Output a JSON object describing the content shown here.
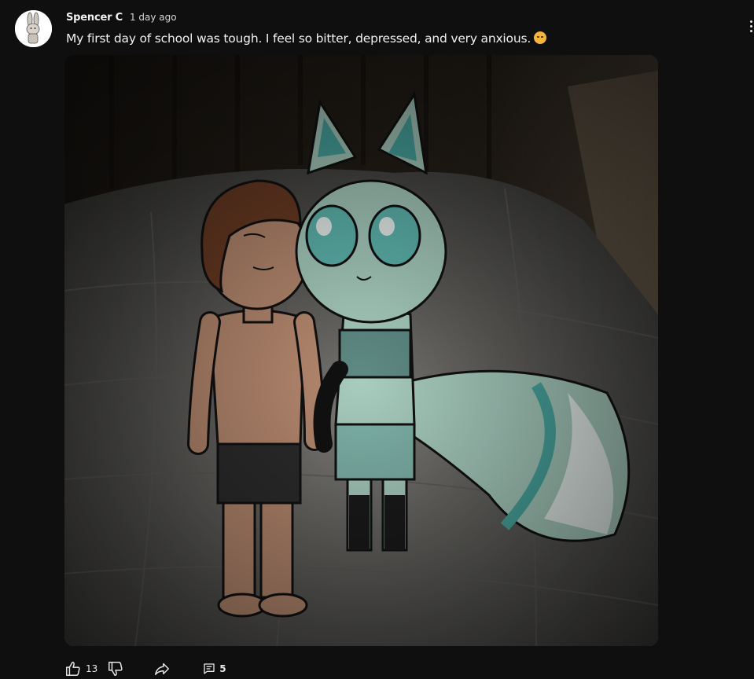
{
  "post": {
    "author": "Spencer C",
    "time_ago": "1 day ago",
    "text": "My first day of school was tough. I feel so bitter, depressed, and very anxious.",
    "emoji_icon": "pensive-face-icon"
  },
  "actions": {
    "like_count": "13",
    "comment_count": "5"
  },
  "icons": {
    "like": "thumbs-up-icon",
    "dislike": "thumbs-down-icon",
    "share": "share-arrow-icon",
    "comments": "comment-icon",
    "menu": "more-vertical-icon"
  },
  "colors": {
    "background": "#0f0f0f",
    "text": "#f1f1f1",
    "character_fox": "#a8d8c8",
    "character_boy_skin": "#c08a6c"
  }
}
